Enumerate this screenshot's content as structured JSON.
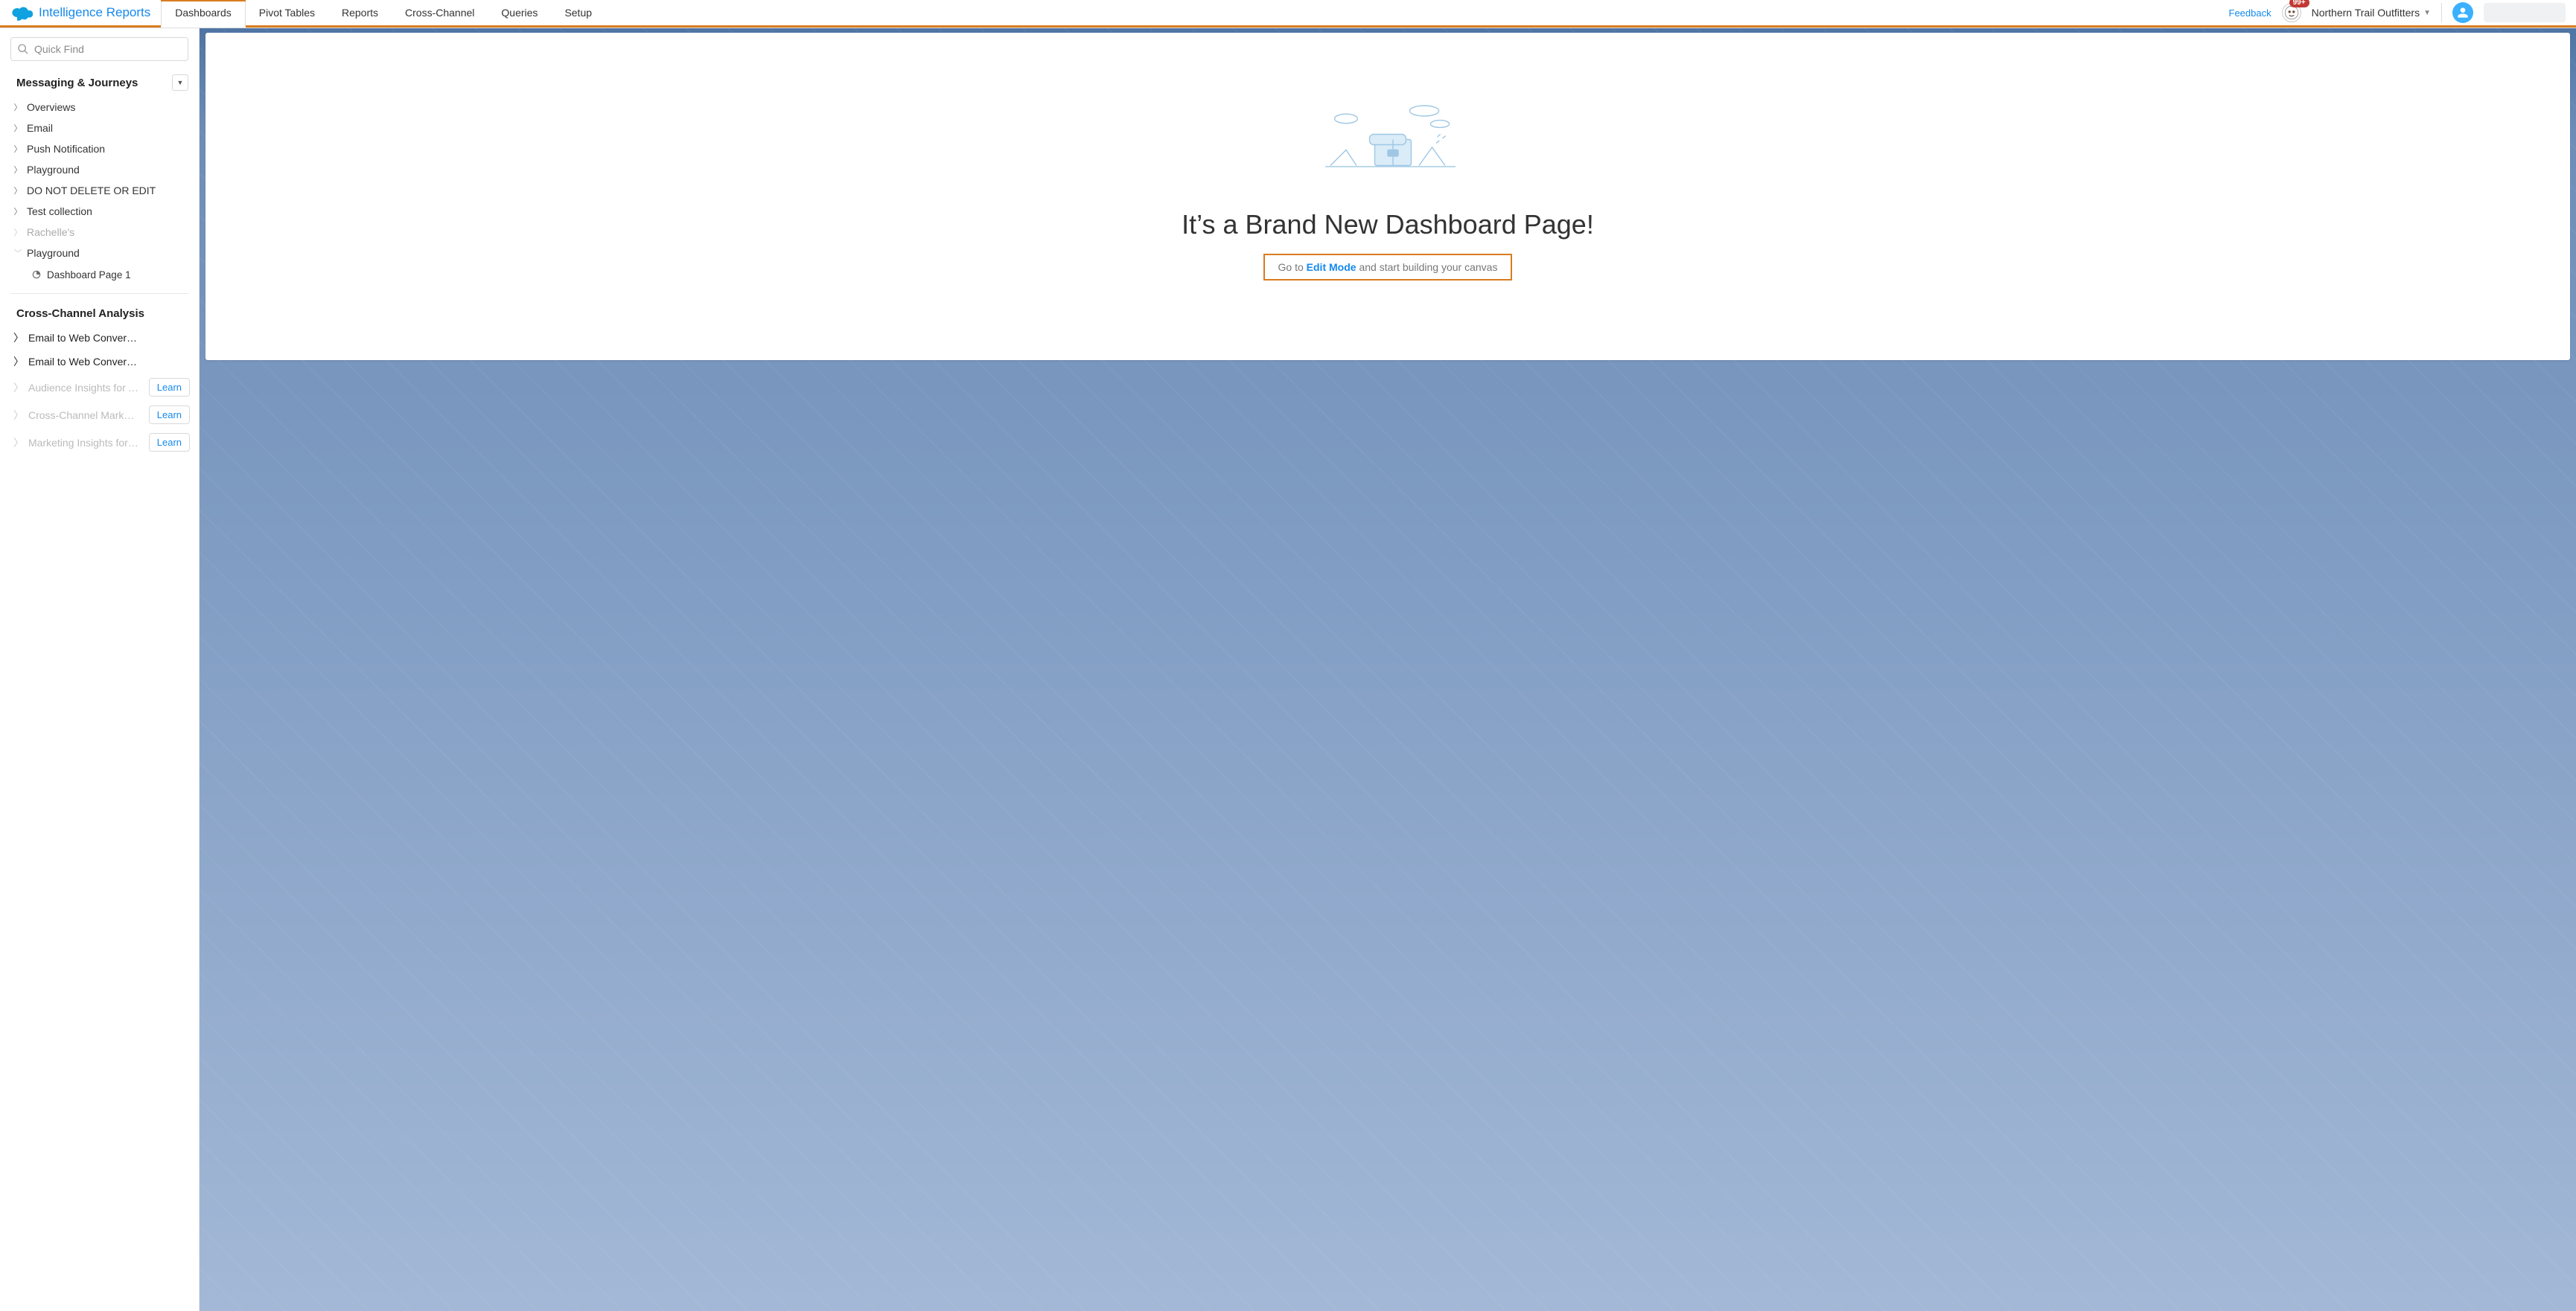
{
  "brand": {
    "title": "Intelligence Reports"
  },
  "tabs": [
    "Dashboards",
    "Pivot Tables",
    "Reports",
    "Cross-Channel",
    "Queries",
    "Setup"
  ],
  "active_tab": 0,
  "top": {
    "feedback": "Feedback",
    "badge": "99+",
    "org": "Northern Trail Outfitters"
  },
  "search": {
    "placeholder": "Quick Find"
  },
  "sidebar": {
    "section1": {
      "title": "Messaging & Journeys",
      "items": [
        {
          "label": "Overviews",
          "chev": "right",
          "muted": false
        },
        {
          "label": "Email",
          "chev": "right",
          "muted": false
        },
        {
          "label": "Push Notification",
          "chev": "right",
          "muted": false
        },
        {
          "label": "Playground",
          "chev": "right",
          "muted": false
        },
        {
          "label": "DO NOT DELETE OR EDIT",
          "chev": "right",
          "muted": false
        },
        {
          "label": "Test collection",
          "chev": "right",
          "muted": false
        },
        {
          "label": "Rachelle's",
          "chev": "right",
          "muted": true
        },
        {
          "label": "Playground",
          "chev": "down",
          "muted": true
        }
      ],
      "child": {
        "label": "Dashboard Page 1"
      }
    },
    "section2": {
      "title": "Cross-Channel Analysis",
      "items": [
        {
          "label": "Email to Web Conversion",
          "chev": "right",
          "muted": false,
          "learn": false
        },
        {
          "label": "Email to Web Conversion",
          "chev": "right",
          "muted": false,
          "learn": false
        },
        {
          "label": "Audience Insights for Adv…",
          "chev": "right",
          "muted": true,
          "learn": true
        },
        {
          "label": "Cross-Channel Marketing …",
          "chev": "right",
          "muted": true,
          "learn": true
        },
        {
          "label": "Marketing Insights for Sal…",
          "chev": "right",
          "muted": true,
          "learn": true
        }
      ],
      "learn_label": "Learn"
    }
  },
  "empty": {
    "title": "It’s a Brand New Dashboard Page!",
    "pre": "Go to ",
    "link": "Edit Mode",
    "post": " and start building your canvas"
  }
}
